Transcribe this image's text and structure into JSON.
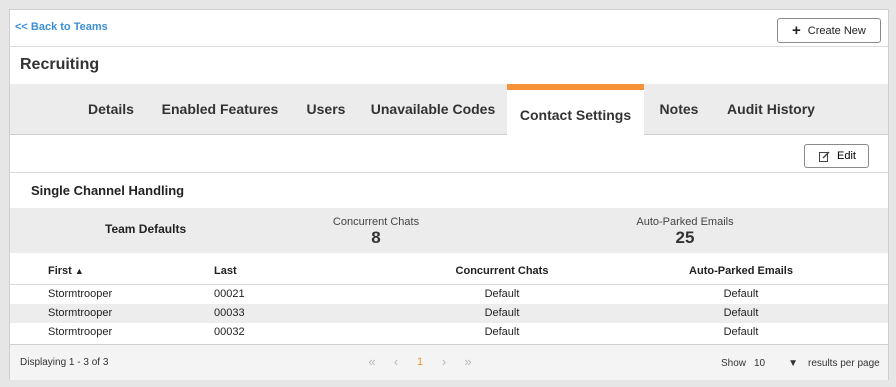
{
  "header": {
    "back_label": "<< Back to Teams",
    "create_label": "Create New",
    "team_title": "Recruiting"
  },
  "tabs": [
    {
      "label": "Details",
      "active": false
    },
    {
      "label": "Enabled Features",
      "active": false
    },
    {
      "label": "Users",
      "active": false
    },
    {
      "label": "Unavailable Codes",
      "active": false
    },
    {
      "label": "Contact Settings",
      "active": true
    },
    {
      "label": "Notes",
      "active": false
    },
    {
      "label": "Audit History",
      "active": false
    }
  ],
  "toolbar": {
    "edit_label": "Edit"
  },
  "section": {
    "title": "Single Channel Handling"
  },
  "defaults": {
    "label": "Team Defaults",
    "chats_label": "Concurrent Chats",
    "chats_value": "8",
    "emails_label": "Auto-Parked Emails",
    "emails_value": "25"
  },
  "table": {
    "columns": [
      "First",
      "Last",
      "Concurrent Chats",
      "Auto-Parked Emails"
    ],
    "rows": [
      [
        "Stormtrooper",
        "00021",
        "Default",
        "Default"
      ],
      [
        "Stormtrooper",
        "00033",
        "Default",
        "Default"
      ],
      [
        "Stormtrooper",
        "00032",
        "Default",
        "Default"
      ]
    ]
  },
  "footer": {
    "display_text": "Displaying 1 - 3 of 3",
    "pager": {
      "first": "«",
      "prev": "‹",
      "page": "1",
      "next": "›",
      "last": "»"
    },
    "show_label": "Show",
    "page_size": "10",
    "rpp_label": "results per page"
  },
  "colors": {
    "accent": "#f7923a",
    "link": "#3b8fd6",
    "band": "#ececec"
  }
}
